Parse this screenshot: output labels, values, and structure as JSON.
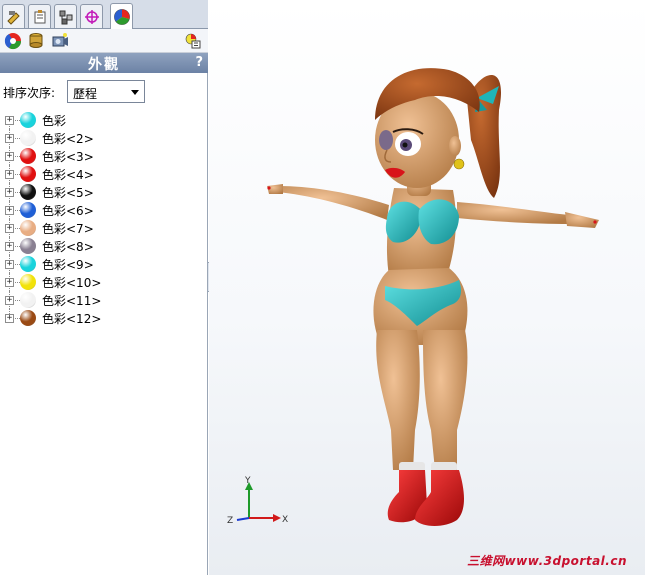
{
  "panel": {
    "tabs": [
      {
        "name": "feature-manager",
        "icon": "feature-tree-icon"
      },
      {
        "name": "property-manager",
        "icon": "property-manager-icon"
      },
      {
        "name": "configuration-manager",
        "icon": "configuration-manager-icon"
      },
      {
        "name": "dimxpert-manager",
        "icon": "crosshair-target-icon"
      },
      {
        "name": "display-manager",
        "icon": "appearance-sphere-icon"
      }
    ],
    "active_tab": 4,
    "title": "外觀",
    "help": "?",
    "sort_label": "排序次序:",
    "sort_value": "歷程",
    "items": [
      {
        "label": "色彩",
        "color": "#19d3dc"
      },
      {
        "label": "色彩<2>",
        "color": "#f2f2f2"
      },
      {
        "label": "色彩<3>",
        "color": "#e01010"
      },
      {
        "label": "色彩<4>",
        "color": "#e01010"
      },
      {
        "label": "色彩<5>",
        "color": "#111111"
      },
      {
        "label": "色彩<6>",
        "color": "#1f5fd6"
      },
      {
        "label": "色彩<7>",
        "color": "#e8ad83"
      },
      {
        "label": "色彩<8>",
        "color": "#8a8092"
      },
      {
        "label": "色彩<9>",
        "color": "#19d3dc"
      },
      {
        "label": "色彩<10>",
        "color": "#f2e20a"
      },
      {
        "label": "色彩<11>",
        "color": "#f2f2f2"
      },
      {
        "label": "色彩<12>",
        "color": "#9a4a14"
      }
    ]
  },
  "viewport": {
    "triad": {
      "x": "X",
      "y": "Y",
      "z": "Z"
    },
    "watermark": "三维网www.3dportal.cn"
  },
  "colors": {
    "skin": "#d9a06a",
    "hair": "#9c4a1a",
    "bikini": "#1fb5b8",
    "boots": "#d8141a"
  }
}
